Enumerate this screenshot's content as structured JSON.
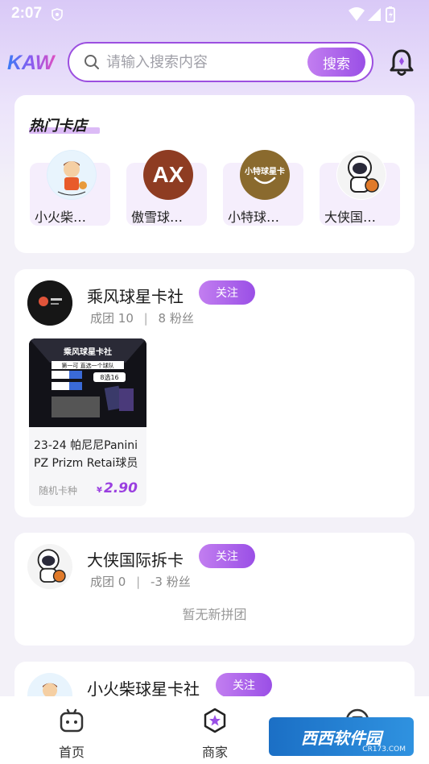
{
  "status_bar": {
    "time": "2:07"
  },
  "header": {
    "logo_text": "KAW",
    "search": {
      "placeholder": "请输入搜索内容",
      "button_label": "搜索"
    }
  },
  "hot_shops": {
    "title": "热门卡店",
    "items": [
      {
        "name": "小火柴…",
        "avatar_text": ""
      },
      {
        "name": "傲雪球…",
        "avatar_text": "AX"
      },
      {
        "name": "小特球…",
        "avatar_text": "小特球星卡"
      },
      {
        "name": "大侠国…",
        "avatar_text": ""
      }
    ]
  },
  "feed": [
    {
      "name": "乘风球星卡社",
      "follow_label": "关注",
      "stats": {
        "groups_label": "成团",
        "groups": "10",
        "fans": "8",
        "fans_label": "粉丝"
      },
      "product": {
        "title": "23-24 帕尼尼Panini PZ Prizm Retai球员",
        "tag": "随机卡种",
        "currency": "¥",
        "price": "2.90",
        "image_banner": "乘风球星卡社",
        "image_line": "第一可 直选一个球队",
        "image_badge": "8选16"
      }
    },
    {
      "name": "大侠国际拆卡",
      "follow_label": "关注",
      "stats": {
        "groups_label": "成团",
        "groups": "0",
        "fans": "-3",
        "fans_label": "粉丝"
      },
      "empty_text": "暂无新拼团"
    },
    {
      "name": "小火柴球星卡社",
      "follow_label": "关注"
    }
  ],
  "bottom_nav": {
    "items": [
      {
        "label": "首页",
        "icon": "home-icon"
      },
      {
        "label": "商家",
        "icon": "merchant-icon"
      },
      {
        "label": "",
        "icon": "profile-icon"
      }
    ]
  },
  "watermark": {
    "main": "西西软件园",
    "sub": "CR173.COM"
  },
  "colors": {
    "accent": "#9a4fe6",
    "accent_light": "#c27ef0",
    "price": "#9a3fe0"
  }
}
